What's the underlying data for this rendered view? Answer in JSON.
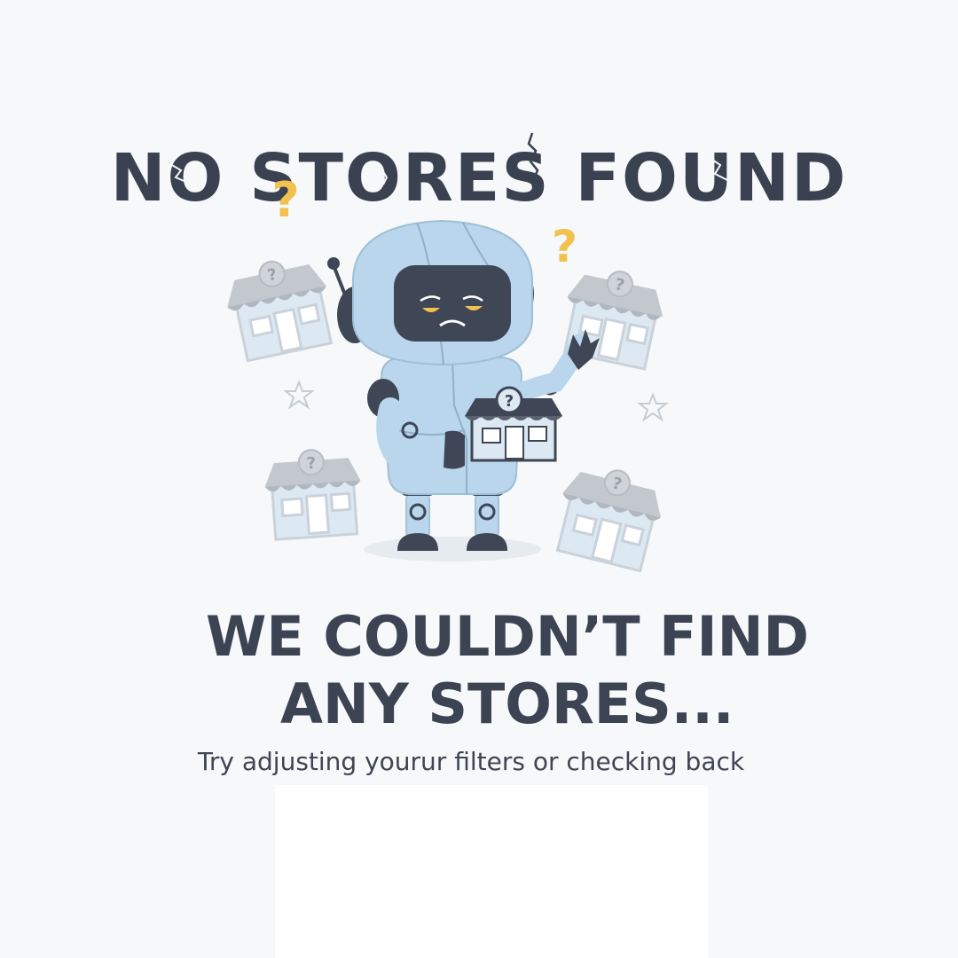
{
  "empty_state": {
    "title": "NO STORES FOUND",
    "headline_line1": "WE COULDN’T FIND",
    "headline_line2": "ANY STORES...",
    "message": "Try adjusting yourur filters or checking back"
  },
  "colors": {
    "background": "#f6f8f9",
    "text": "#3a4150",
    "robot_body": "#b9d6ec",
    "robot_dark": "#3f4656",
    "accent_question": "#f2c14e",
    "store_awning": "#b8bdc4",
    "store_body": "#dce9f3"
  },
  "icons": {
    "mascot": "robot-mascot",
    "store": "store-icon",
    "question": "question-mark-icon",
    "star": "star-icon"
  }
}
